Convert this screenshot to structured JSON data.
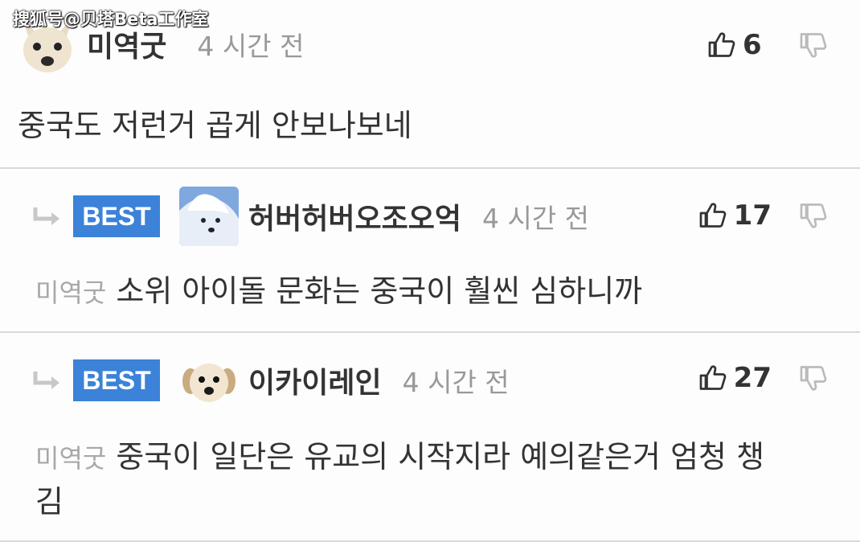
{
  "watermark": "搜狐号@贝塔Beta工作室",
  "comments": [
    {
      "avatar": "dog-avatar",
      "username": "미역굿",
      "time": "4 시간 전",
      "likes": "6",
      "text": "중국도 저런거 곱게 안보나보네"
    },
    {
      "badge": "BEST",
      "avatar": "white-dog-avatar",
      "username": "허버허버오조오억",
      "time": "4 시간 전",
      "likes": "17",
      "mention": "미역굿",
      "text": " 소위 아이돌 문화는 중국이 훨씬 심하니까"
    },
    {
      "badge": "BEST",
      "avatar": "puppy-avatar",
      "username": "이카이레인",
      "time": "4 시간 전",
      "likes": "27",
      "mention": "미역굿",
      "text_line1": " 중국이 일단은 유교의 시작지라 예의같은거 엄청 챙",
      "text_line2": "김"
    }
  ],
  "icons": {
    "like": "thumbs-up-icon",
    "dislike": "thumbs-down-icon",
    "reply": "reply-arrow-icon"
  },
  "colors": {
    "best_badge": "#3b82d8",
    "muted": "#999999",
    "divider": "#d9d9d9"
  }
}
